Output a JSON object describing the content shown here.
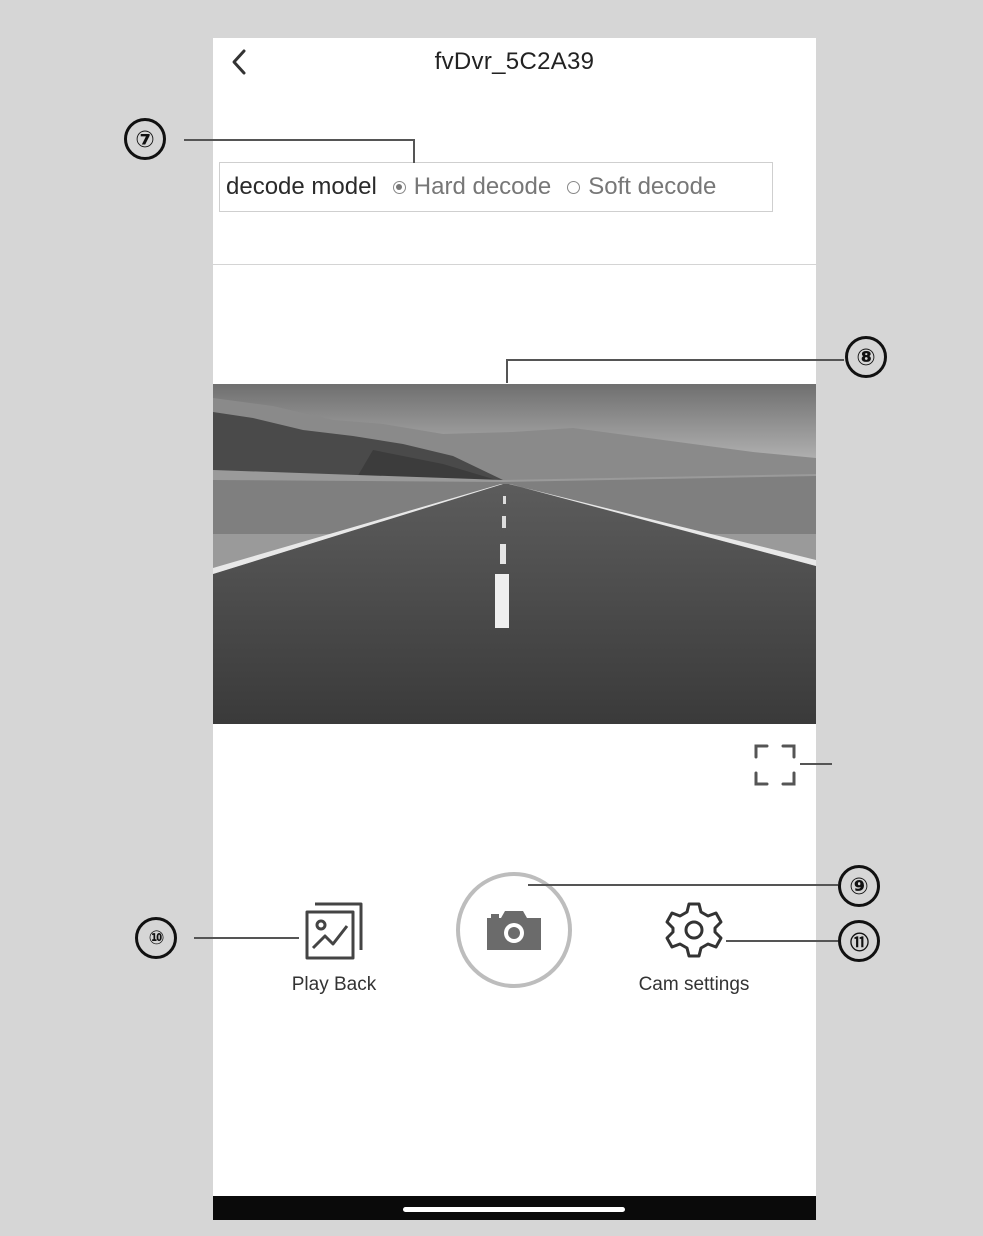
{
  "header": {
    "title": "fvDvr_5C2A39",
    "back_icon": "chevron-left-icon"
  },
  "decode": {
    "label": "decode model",
    "options": [
      {
        "label": "Hard decode",
        "selected": true
      },
      {
        "label": "Soft decode",
        "selected": false
      }
    ]
  },
  "video": {
    "description_icon": "road-preview-image",
    "fullscreen_icon": "fullscreen-icon"
  },
  "actions": {
    "playback": {
      "label": "Play Back",
      "icon": "gallery-icon"
    },
    "capture": {
      "icon": "camera-icon"
    },
    "settings": {
      "label": "Cam settings",
      "icon": "gear-icon"
    }
  },
  "callouts": [
    "⑦",
    "⑧",
    "⑨",
    "⑩",
    "⑪"
  ]
}
